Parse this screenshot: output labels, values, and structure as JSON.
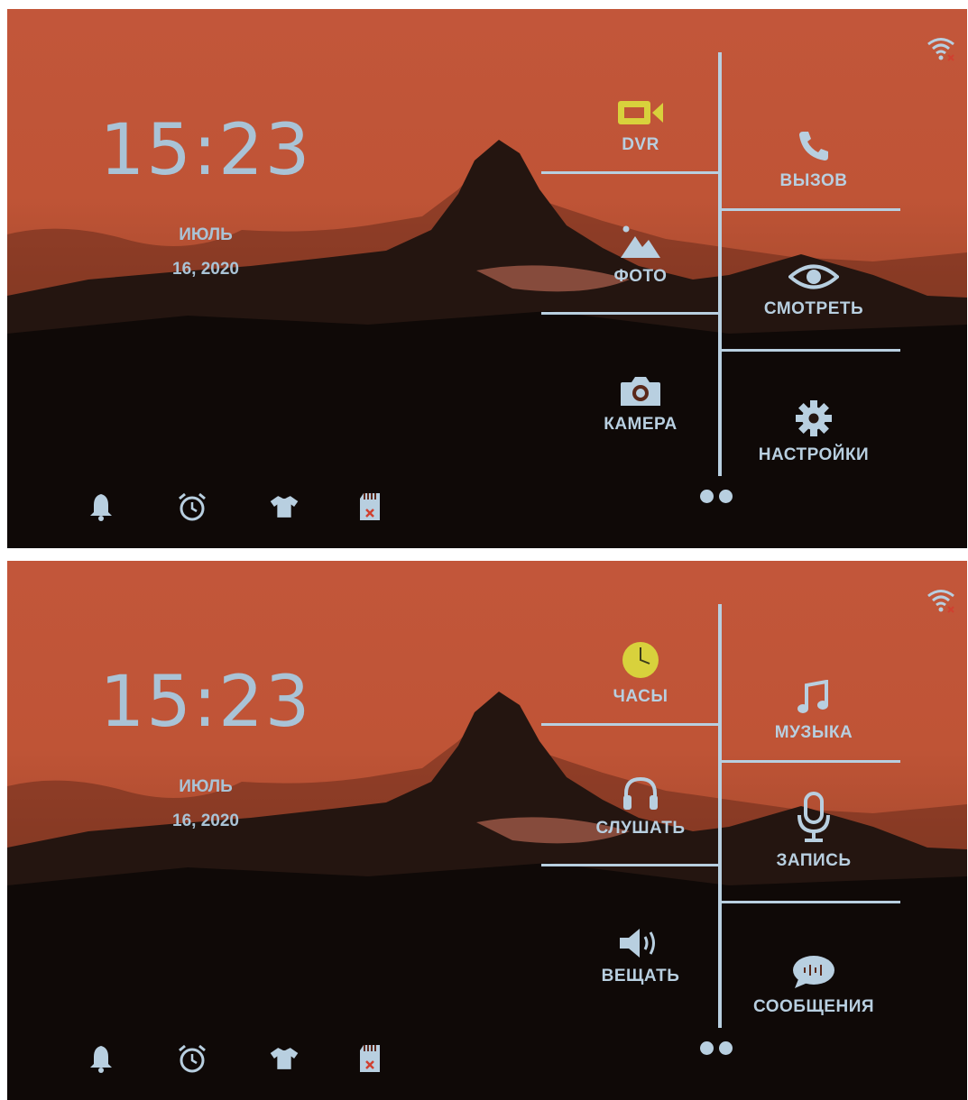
{
  "screens": [
    {
      "time": "15:23",
      "month": "ИЮЛЬ",
      "date": "16, 2020",
      "left_tiles": [
        {
          "label": "DVR",
          "icon": "video-camera-icon"
        },
        {
          "label": "ФОТО",
          "icon": "photo-icon"
        },
        {
          "label": "КАМЕРА",
          "icon": "camera-icon"
        }
      ],
      "right_tiles": [
        {
          "label": "ВЫЗОВ",
          "icon": "phone-icon"
        },
        {
          "label": "СМОТРЕТЬ",
          "icon": "eye-icon"
        },
        {
          "label": "НАСТРОЙКИ",
          "icon": "gear-icon"
        }
      ],
      "page_indicator": {
        "pages": 2
      }
    },
    {
      "time": "15:23",
      "month": "ИЮЛЬ",
      "date": "16, 2020",
      "left_tiles": [
        {
          "label": "ЧАСЫ",
          "icon": "clock-icon"
        },
        {
          "label": "СЛУШАТЬ",
          "icon": "headphones-icon"
        },
        {
          "label": "ВЕЩАТЬ",
          "icon": "speaker-icon"
        }
      ],
      "right_tiles": [
        {
          "label": "МУЗЫКА",
          "icon": "music-note-icon"
        },
        {
          "label": "ЗАПИСЬ",
          "icon": "microphone-icon"
        },
        {
          "label": "СООБЩЕНИЯ",
          "icon": "message-icon"
        }
      ],
      "page_indicator": {
        "pages": 2
      }
    }
  ],
  "status_icons": [
    "bell-icon",
    "alarm-clock-icon",
    "shirt-icon",
    "sd-card-missing-icon"
  ],
  "colors": {
    "accent": "#b8cfe0",
    "highlight": "#d8d13c",
    "sky": "#c2563a"
  }
}
